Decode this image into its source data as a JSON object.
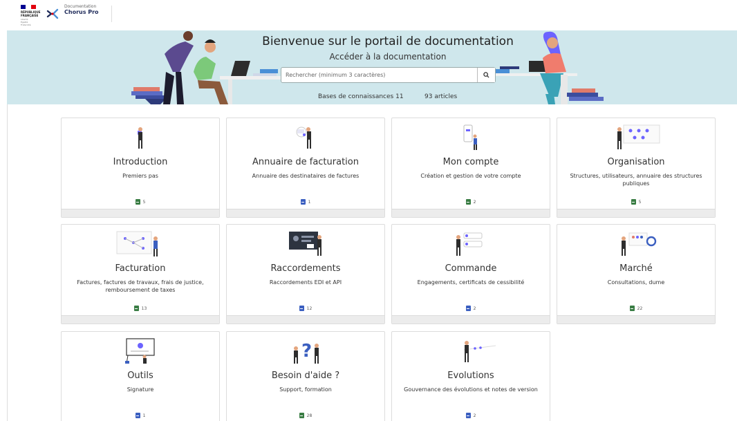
{
  "header": {
    "republic_lines": [
      "RÉPUBLIQUE",
      "FRANÇAISE"
    ],
    "motto_lines": [
      "Liberté",
      "Égalité",
      "Fraternité"
    ],
    "app_subtitle": "Documentation",
    "app_name": "Chorus Pro",
    "flag_colors": [
      "#000091",
      "#ffffff",
      "#e1000f"
    ]
  },
  "hero": {
    "title": "Bienvenue sur le portail de documentation",
    "subtitle": "Accéder à la documentation",
    "search": {
      "placeholder": "Rechercher (minimum 3 caractères)",
      "value": "",
      "button_icon": "search-icon"
    },
    "stats": {
      "knowledge_bases": "Bases de connaissances 11",
      "articles": "93 articles"
    }
  },
  "colors": {
    "accent": "#1f2b5a",
    "hero_bg": "#cfe7ec",
    "doc_green": "#3a7d44",
    "doc_blue": "#3b5fc0",
    "illustration_purple": "#6c63ff"
  },
  "cards": [
    {
      "title": "Introduction",
      "description": "Premiers pas",
      "count": "5",
      "doc_color": "green",
      "icon": "person-reading-icon"
    },
    {
      "title": "Annuaire de facturation",
      "description": "Annuaire des destinataires de factures",
      "count": "1",
      "doc_color": "blue",
      "icon": "person-search-icon"
    },
    {
      "title": "Mon compte",
      "description": "Création et gestion de votre compte",
      "count": "2",
      "doc_color": "green",
      "icon": "person-phone-icon"
    },
    {
      "title": "Organisation",
      "description": "Structures, utilisateurs, annuaire des structures publiques",
      "count": "5",
      "doc_color": "green",
      "icon": "person-board-icon"
    },
    {
      "title": "Facturation",
      "description": "Factures, factures de travaux, frais de justice, remboursement de taxes",
      "count": "13",
      "doc_color": "green",
      "icon": "person-flowchart-icon"
    },
    {
      "title": "Raccordements",
      "description": "Raccordements EDI et API",
      "count": "12",
      "doc_color": "blue",
      "icon": "person-screen-icon"
    },
    {
      "title": "Commande",
      "description": "Engagements, certificats de cessibilité",
      "count": "2",
      "doc_color": "blue",
      "icon": "person-cards-icon"
    },
    {
      "title": "Marché",
      "description": "Consultations, dume",
      "count": "22",
      "doc_color": "green",
      "icon": "person-chart-icon"
    },
    {
      "title": "Outils",
      "description": "Signature",
      "count": "1",
      "doc_color": "blue",
      "icon": "person-whiteboard-icon"
    },
    {
      "title": "Besoin d'aide ?",
      "description": "Support, formation",
      "count": "28",
      "doc_color": "green",
      "icon": "person-question-icon"
    },
    {
      "title": "Evolutions",
      "description": "Gouvernance des évolutions et notes de version",
      "count": "2",
      "doc_color": "blue",
      "icon": "person-timeline-icon"
    }
  ]
}
